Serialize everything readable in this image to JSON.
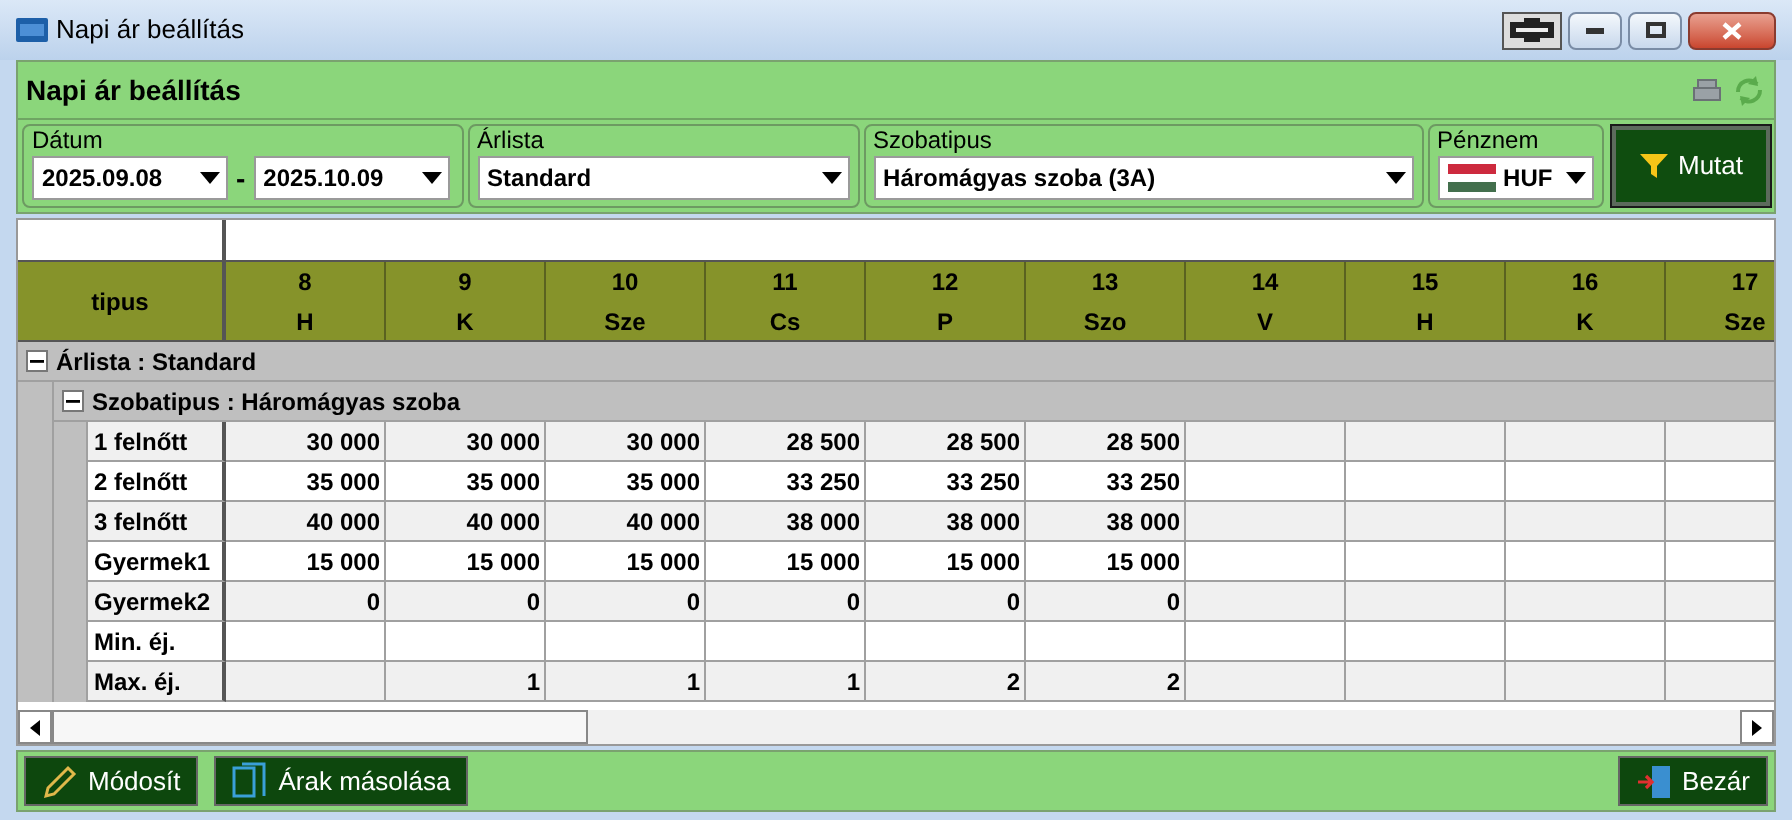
{
  "window": {
    "title": "Napi ár beállítás"
  },
  "header": {
    "title": "Napi ár beállítás"
  },
  "filters": {
    "date": {
      "label": "Dátum",
      "from": "2025.09.08",
      "separator": "-",
      "to": "2025.10.09"
    },
    "price_list": {
      "label": "Árlista",
      "value": "Standard"
    },
    "room_type": {
      "label": "Szobatipus",
      "value": "Háromágyas szoba (3A)"
    },
    "currency": {
      "label": "Pénznem",
      "value": "HUF"
    }
  },
  "show_button": {
    "label": "Mutat"
  },
  "grid": {
    "corner": "tipus",
    "columns": [
      {
        "day": "8",
        "weekday": "H"
      },
      {
        "day": "9",
        "weekday": "K"
      },
      {
        "day": "10",
        "weekday": "Sze"
      },
      {
        "day": "11",
        "weekday": "Cs"
      },
      {
        "day": "12",
        "weekday": "P"
      },
      {
        "day": "13",
        "weekday": "Szo"
      },
      {
        "day": "14",
        "weekday": "V"
      },
      {
        "day": "15",
        "weekday": "H"
      },
      {
        "day": "16",
        "weekday": "K"
      },
      {
        "day": "17",
        "weekday": "Sze"
      }
    ],
    "groups": [
      {
        "label": "Árlista : Standard",
        "expanded": true,
        "children": [
          {
            "label": "Szobatipus : Háromágyas szoba",
            "expanded": true,
            "rows": [
              {
                "label": "1 felnőtt",
                "cells": [
                  "30 000",
                  "30 000",
                  "30 000",
                  "28 500",
                  "28 500",
                  "28 500"
                ]
              },
              {
                "label": "2 felnőtt",
                "cells": [
                  "35 000",
                  "35 000",
                  "35 000",
                  "33 250",
                  "33 250",
                  "33 250"
                ]
              },
              {
                "label": "3 felnőtt",
                "cells": [
                  "40 000",
                  "40 000",
                  "40 000",
                  "38 000",
                  "38 000",
                  "38 000"
                ]
              },
              {
                "label": "Gyermek1",
                "cells": [
                  "15 000",
                  "15 000",
                  "15 000",
                  "15 000",
                  "15 000",
                  "15 000"
                ]
              },
              {
                "label": "Gyermek2",
                "cells": [
                  "0",
                  "0",
                  "0",
                  "0",
                  "0",
                  "0"
                ]
              },
              {
                "label": "Min. éj.",
                "cells": []
              },
              {
                "label": "Max. éj.",
                "cells": [
                  null,
                  "1",
                  "1",
                  "1",
                  "2",
                  "2"
                ]
              }
            ]
          }
        ]
      }
    ]
  },
  "buttons": [
    {
      "label": "Módosít",
      "kind": "edit"
    },
    {
      "label": "Árak másolása",
      "kind": "copy"
    },
    {
      "label": "Bezár",
      "kind": "close"
    }
  ]
}
